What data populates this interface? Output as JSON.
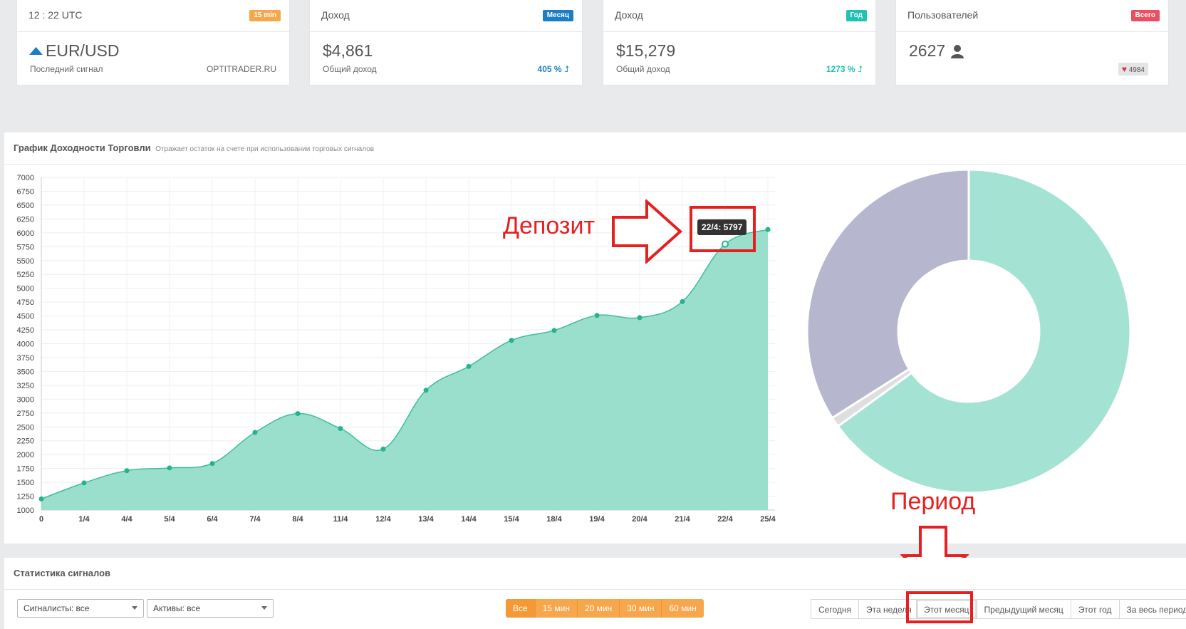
{
  "cards": [
    {
      "title": "12 : 22 UTC",
      "badge": "15 min",
      "badge_color": "#f6a64b",
      "value": "EUR/USD",
      "sub": "Последний сигнал",
      "right": "OPTITRADER.RU"
    },
    {
      "title": "Доход",
      "badge": "Месяц",
      "badge_color": "#1c7fc4",
      "value": "$4,861",
      "sub": "Общий доход",
      "right": "405 %",
      "right_color": "#1c7fc4"
    },
    {
      "title": "Доход",
      "badge": "Год",
      "badge_color": "#1fc2b3",
      "value": "$15,279",
      "sub": "Общий доход",
      "right": "1273 %",
      "right_color": "#1fc2b3"
    },
    {
      "title": "Пользователей",
      "badge": "Всего",
      "badge_color": "#ec4f61",
      "value": "2627",
      "likes": "4984"
    }
  ],
  "chart_panel": {
    "title": "График Доходности Торговли",
    "subtitle": "Отражает остаток на счете при использовании торговых сигналов"
  },
  "tooltip": "22/4: 5797",
  "annotations": {
    "deposit": "Депозит",
    "period": "Период"
  },
  "chart_data": [
    {
      "type": "area",
      "categories": [
        "0",
        "1/4",
        "4/4",
        "5/4",
        "6/4",
        "7/4",
        "8/4",
        "11/4",
        "12/4",
        "13/4",
        "14/4",
        "15/4",
        "18/4",
        "19/4",
        "20/4",
        "21/4",
        "22/4",
        "25/4"
      ],
      "values": [
        1200,
        1490,
        1710,
        1760,
        1840,
        2400,
        2740,
        2470,
        2100,
        3160,
        3590,
        4060,
        4240,
        4510,
        4470,
        4760,
        5797,
        6060
      ],
      "ylim": [
        1000,
        7000
      ],
      "yticks": [
        1000,
        1250,
        1500,
        1750,
        2000,
        2250,
        2500,
        2750,
        3000,
        3250,
        3500,
        3750,
        4000,
        4250,
        4500,
        4750,
        5000,
        5250,
        5500,
        5750,
        6000,
        6250,
        6500,
        6750,
        7000
      ],
      "color": "#8fdac6",
      "grid": true
    },
    {
      "type": "pie",
      "style": "donut",
      "values": [
        65,
        1,
        34
      ],
      "colors": [
        "#a4e3d4",
        "#dedede",
        "#b6b6cf"
      ]
    }
  ],
  "stats_panel": {
    "title": "Статистика сигналов"
  },
  "filters": {
    "signalers": "Сигналисты: все",
    "assets": "Активы: все"
  },
  "timeframes": [
    "Все",
    "15 мин",
    "20 мин",
    "30 мин",
    "60 мин"
  ],
  "periods": [
    "Сегодня",
    "Эта неделя",
    "Этот месяц",
    "Предыдущий месяц",
    "Этот год",
    "За весь период"
  ]
}
